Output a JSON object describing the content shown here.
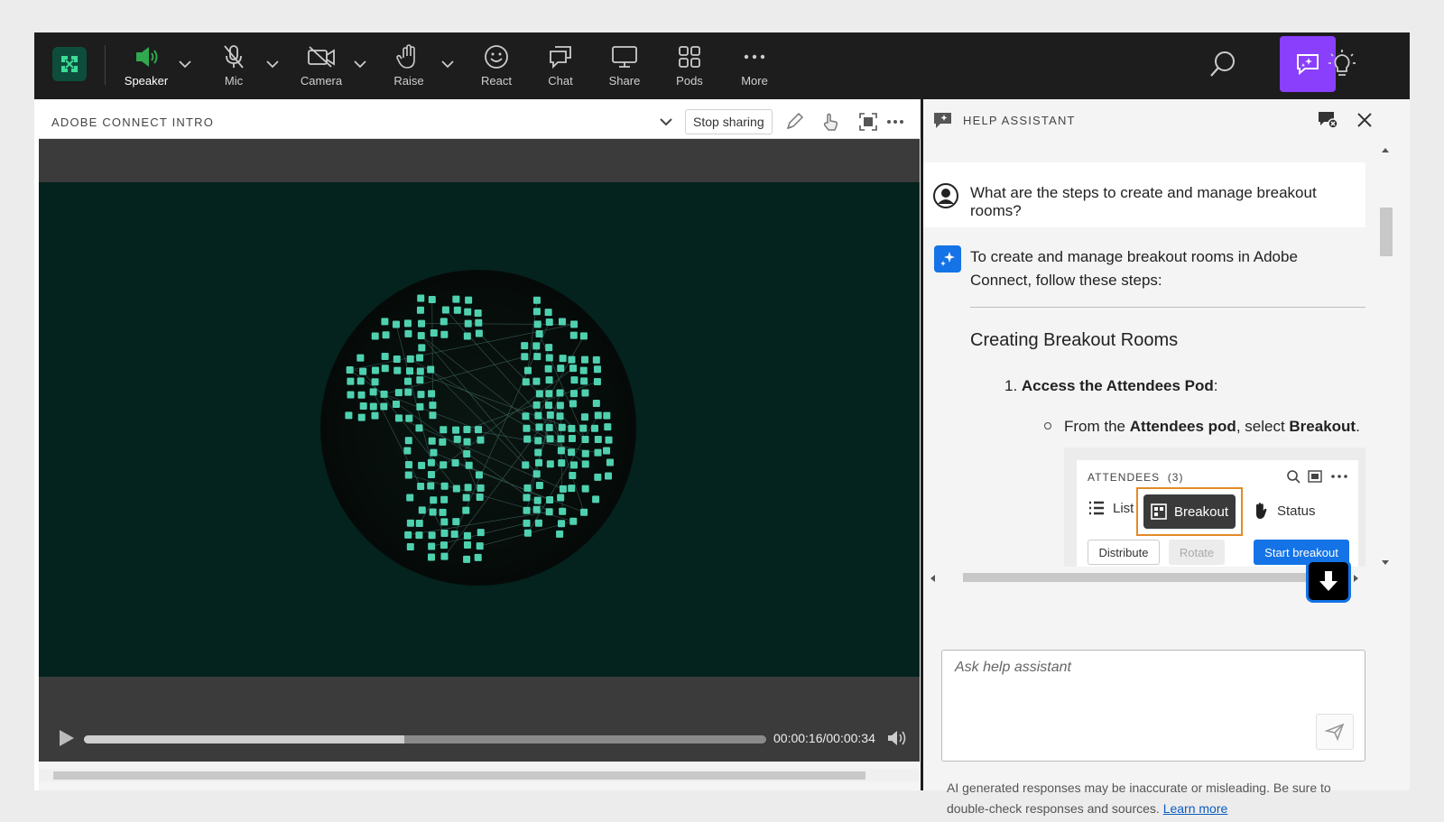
{
  "toolbar": {
    "items": [
      {
        "label": "Speaker",
        "icon": "speaker-icon"
      },
      {
        "label": "Mic",
        "icon": "mic-off-icon"
      },
      {
        "label": "Camera",
        "icon": "camera-off-icon"
      },
      {
        "label": "Raise",
        "icon": "raise-hand-icon"
      },
      {
        "label": "React",
        "icon": "smile-icon"
      },
      {
        "label": "Chat",
        "icon": "chat-icon"
      },
      {
        "label": "Share",
        "icon": "share-screen-icon"
      },
      {
        "label": "Pods",
        "icon": "pods-icon"
      },
      {
        "label": "More",
        "icon": "more-icon"
      }
    ],
    "accent_color": "#8a3ffc",
    "speaker_color": "#2fa84f"
  },
  "pod": {
    "title": "ADOBE CONNECT INTRO",
    "stop_sharing_label": "Stop sharing",
    "time": "00:00:16/00:00:34",
    "progress": 0.47
  },
  "help": {
    "title": "HELP ASSISTANT",
    "question": "What are the steps to create and manage breakout rooms?",
    "answer_intro": "To create and manage breakout rooms in Adobe Connect, follow these steps:",
    "heading": "Creating Breakout Rooms",
    "step1_prefix": "1. ",
    "step1_bold": "Access the Attendees Pod",
    "step1_suffix": ":",
    "bullet_prefix": "From the ",
    "bullet_bold1": "Attendees pod",
    "bullet_mid": ", select ",
    "bullet_bold2": "Breakout",
    "bullet_suffix": ".",
    "screenshot": {
      "title": "ATTENDEES  (3)",
      "list_label": "List",
      "breakout_label": "Breakout",
      "status_label": "Status",
      "distribute_label": "Distribute",
      "rotate_label": "Rotate",
      "start_label": "Start breakout"
    },
    "input_placeholder": "Ask help assistant",
    "disclaimer": "AI generated responses may be inaccurate or misleading. Be sure to double-check responses and sources. ",
    "learn_more": "Learn more"
  }
}
